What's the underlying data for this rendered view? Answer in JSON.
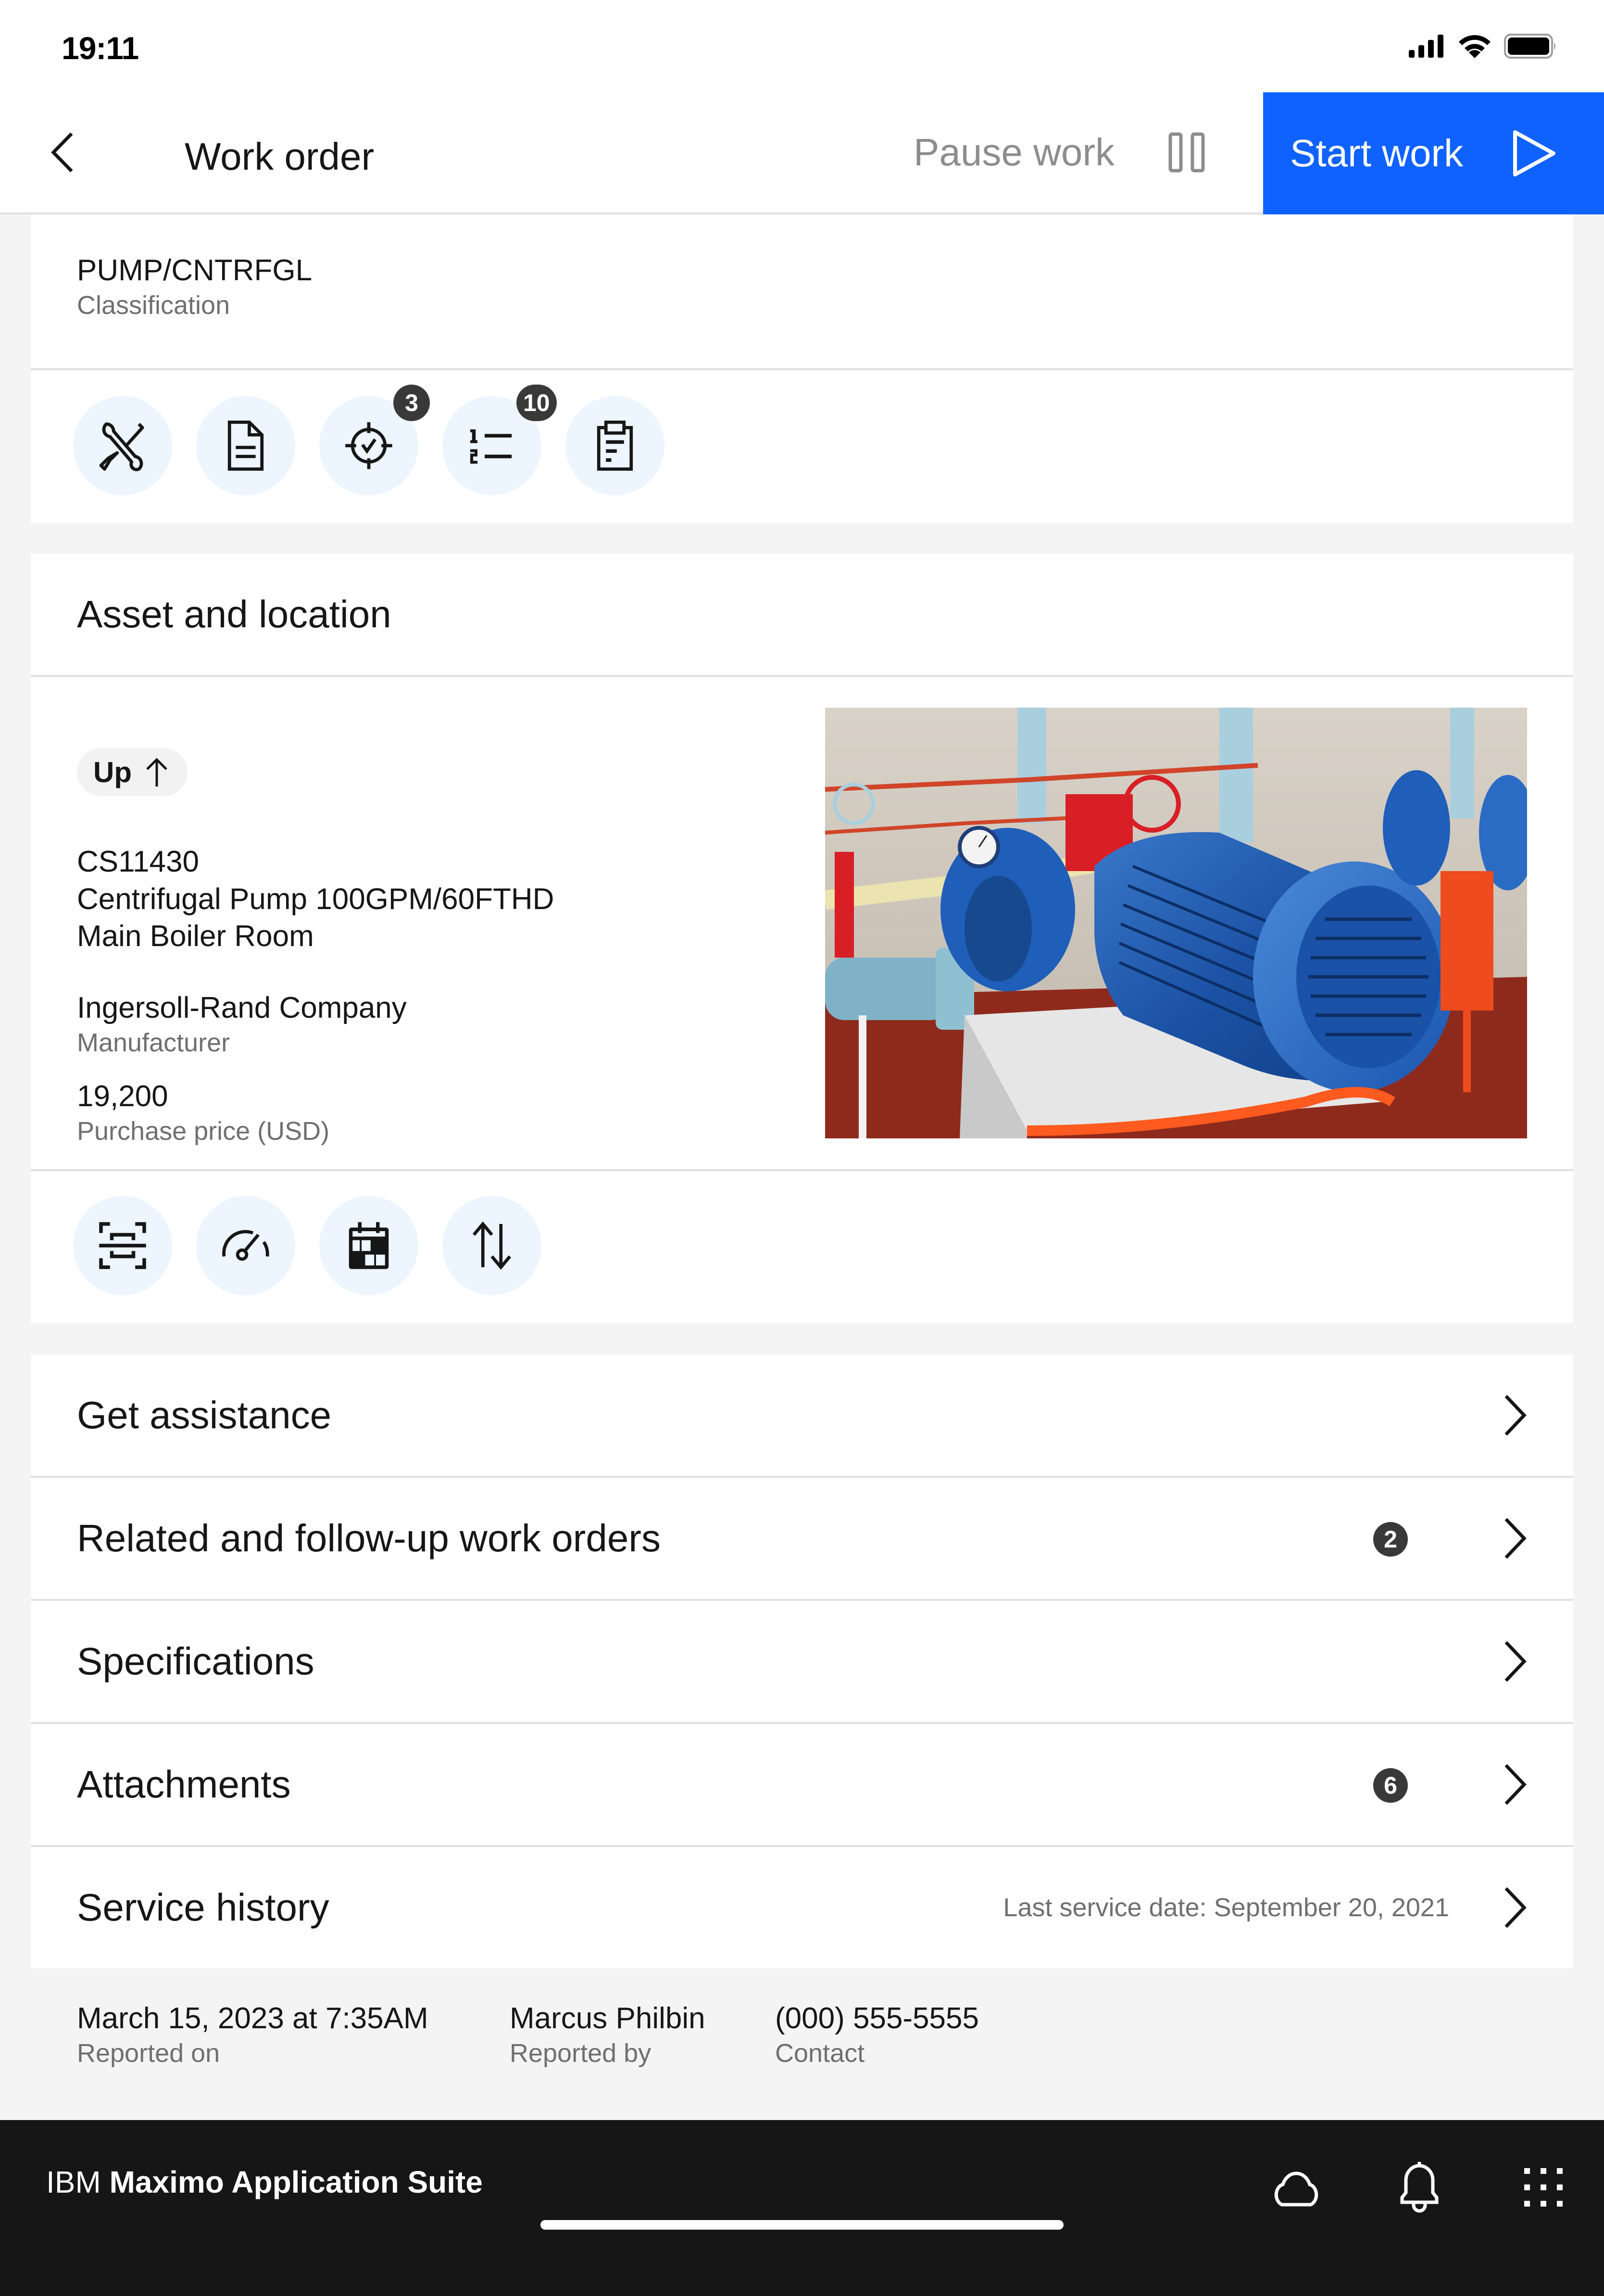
{
  "status_bar": {
    "time": "19:11",
    "icons": [
      "cellular-signal-icon",
      "wifi-icon",
      "battery-icon"
    ]
  },
  "header": {
    "title": "Work order",
    "back_icon": "chevron-left-icon",
    "pause": {
      "label": "Pause work",
      "icon": "pause-icon"
    },
    "start": {
      "label": "Start work",
      "icon": "play-icon"
    }
  },
  "colors": {
    "primary": "#0f62fe",
    "icon_bg": "#edf5ff",
    "badge_bg": "#393939",
    "page_bg": "#f4f4f4",
    "bottom_bar": "#161616",
    "muted_text": "#6f6f6f",
    "disabled_text": "#8d8d8d"
  },
  "classification": {
    "value": "PUMP/CNTRFGL",
    "label": "Classification"
  },
  "work_actions": [
    {
      "name": "tools",
      "icon": "tools-icon",
      "badge": null
    },
    {
      "name": "details",
      "icon": "document-icon",
      "badge": null
    },
    {
      "name": "assessment",
      "icon": "target-check-icon",
      "badge": "3"
    },
    {
      "name": "tasks",
      "icon": "numbered-list-icon",
      "badge": "10"
    },
    {
      "name": "report",
      "icon": "clipboard-icon",
      "badge": null
    }
  ],
  "asset_section": {
    "title": "Asset and location",
    "status": {
      "label": "Up",
      "icon": "arrow-up-icon"
    },
    "asset_id": "CS11430",
    "description": "Centrifugal Pump 100GPM/60FTHD",
    "location": "Main Boiler Room",
    "manufacturer": {
      "value": "Ingersoll-Rand Company",
      "label": "Manufacturer"
    },
    "purchase_price": {
      "value": "19,200",
      "label": "Purchase price (USD)"
    },
    "photo_alt": "Blue centrifugal pump and motor in boiler room",
    "actions": [
      {
        "name": "scan",
        "icon": "scan-icon"
      },
      {
        "name": "meters",
        "icon": "meter-gauge-icon"
      },
      {
        "name": "schedule",
        "icon": "calendar-icon"
      },
      {
        "name": "data-transfer",
        "icon": "arrows-up-down-icon"
      }
    ]
  },
  "list_rows": [
    {
      "label": "Get assistance",
      "badge": null,
      "meta": null
    },
    {
      "label": "Related and follow-up work orders",
      "badge": "2",
      "meta": null
    },
    {
      "label": "Specifications",
      "badge": null,
      "meta": null
    },
    {
      "label": "Attachments",
      "badge": "6",
      "meta": null
    },
    {
      "label": "Service history",
      "badge": null,
      "meta": "Last service date: September 20, 2021"
    }
  ],
  "report_info": [
    {
      "value": "March 15, 2023 at 7:35AM",
      "label": "Reported on"
    },
    {
      "value": "Marcus Philbin",
      "label": "Reported by"
    },
    {
      "value": "(000) 555-5555",
      "label": "Contact"
    }
  ],
  "bottom_bar": {
    "brand_prefix": "IBM",
    "brand_name": "Maximo Application Suite",
    "icons": [
      "cloud-icon",
      "notification-bell-icon",
      "app-switcher-icon"
    ]
  }
}
